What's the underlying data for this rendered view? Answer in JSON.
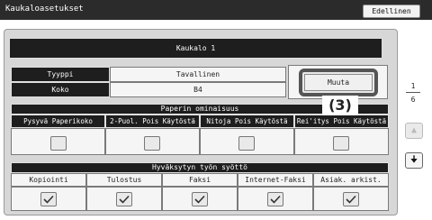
{
  "window": {
    "title": "Kaukaloasetukset",
    "back_label": "Edellinen"
  },
  "tray": {
    "title": "Kaukalo 1"
  },
  "type_row": {
    "label": "Tyyppi",
    "value": "Tavallinen"
  },
  "size_row": {
    "label": "Koko",
    "value": "B4"
  },
  "change_button": {
    "label": "Muuta"
  },
  "step_badge": "(3)",
  "paper_properties": {
    "header": "Paperin ominaisuus",
    "columns": [
      {
        "label": "Pysyvä Paperikoko",
        "checked": false
      },
      {
        "label": "2-Puol. Pois Käytöstä",
        "checked": false
      },
      {
        "label": "Nitoja Pois Käytöstä",
        "checked": false
      },
      {
        "label": "Rei'itys Pois Käytöstä",
        "checked": false
      }
    ]
  },
  "approved_jobs": {
    "header": "Hyväksytyn työn syöttö",
    "columns": [
      {
        "label": "Kopiointi",
        "checked": true
      },
      {
        "label": "Tulostus",
        "checked": true
      },
      {
        "label": "Faksi",
        "checked": true
      },
      {
        "label": "Internet-Faksi",
        "checked": true
      },
      {
        "label": "Asiak. arkist.",
        "checked": true
      }
    ]
  },
  "pagination": {
    "current": "1",
    "total": "6"
  },
  "icons": {
    "up": "arrow-up-icon",
    "down": "arrow-down-icon",
    "check": "checkmark-icon"
  }
}
